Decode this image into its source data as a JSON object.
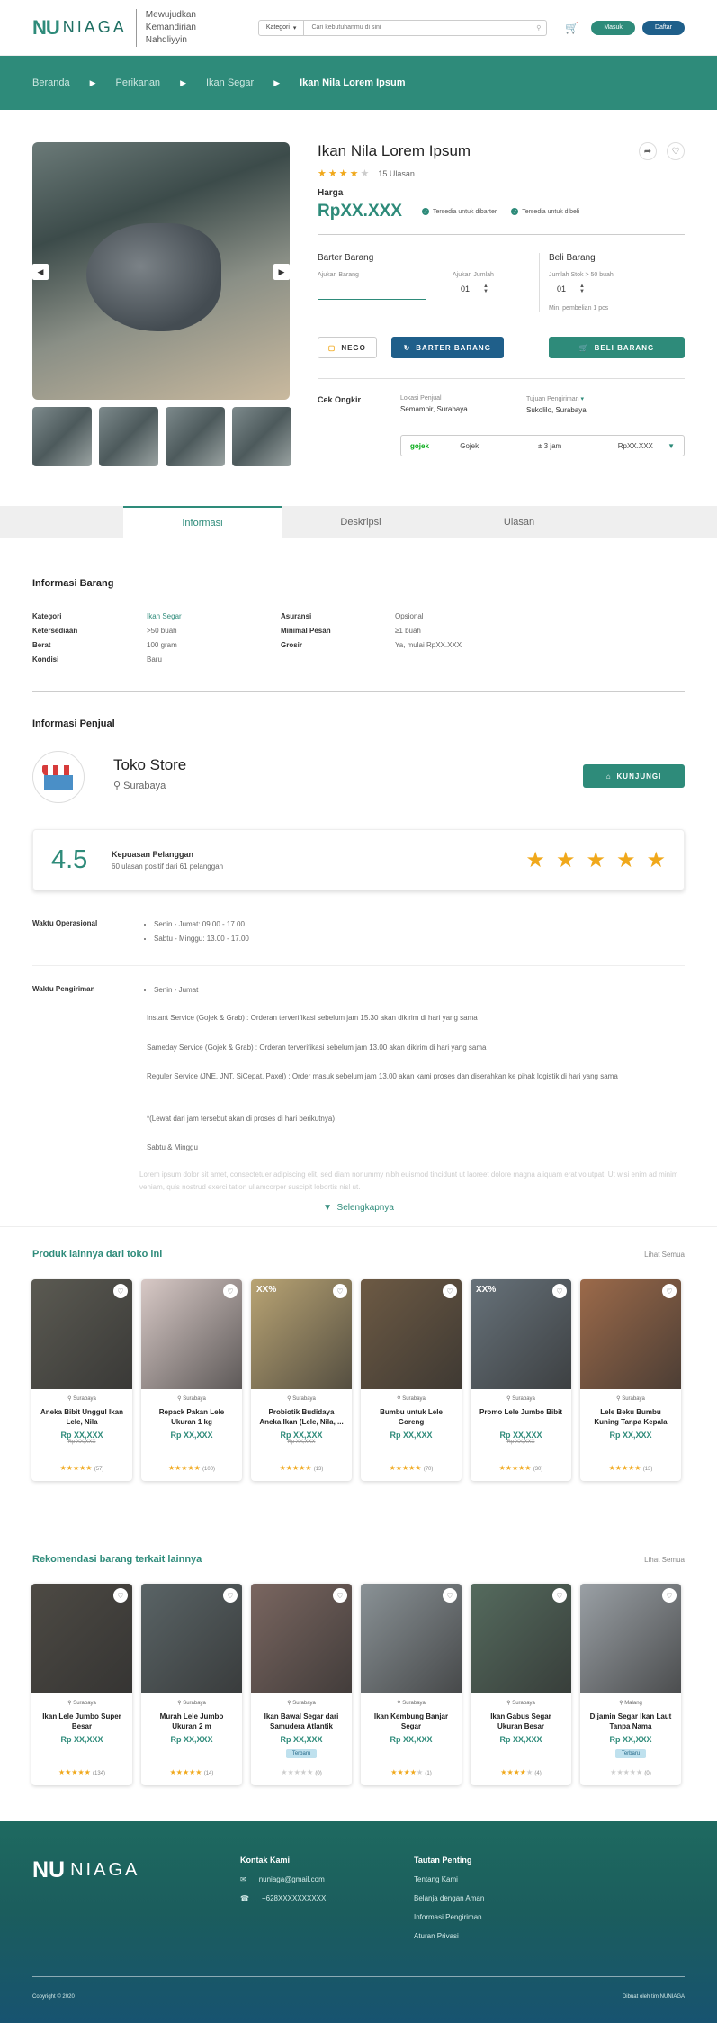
{
  "header": {
    "logo_nu": "NU",
    "logo_niaga": "NIAGA",
    "tagline": "Mewujudkan Kemandirian Nahdliyyin",
    "category_label": "Kategori",
    "search_placeholder": "Cari kebutuhanmu di sini",
    "login_label": "Masuk",
    "register_label": "Daftar"
  },
  "breadcrumb": [
    "Beranda",
    "Perikanan",
    "Ikan Segar",
    "Ikan Nila Lorem Ipsum"
  ],
  "product": {
    "title": "Ikan Nila Lorem Ipsum",
    "rating": 4,
    "reviews": "15 Ulasan",
    "price_label": "Harga",
    "price": "RpXX.XXX",
    "badge_barter": "Tersedia untuk dibarter",
    "badge_beli": "Tersedia untuk dibeli",
    "barter_heading": "Barter Barang",
    "barter_ajukan": "Ajukan Barang",
    "barter_qty_label": "Ajukan Jumlah",
    "barter_qty": "01",
    "beli_heading": "Beli Barang",
    "beli_stock": "Jumlah Stok > 50 buah",
    "beli_qty": "01",
    "beli_min": "Min. pembelian 1 pcs",
    "btn_nego": "NEGO",
    "btn_barter": "BARTER BARANG",
    "btn_beli": "BELI BARANG",
    "ongkir_label": "Cek Ongkir",
    "lokasi_label": "Lokasi Penjual",
    "lokasi_value": "Semampir, Surabaya",
    "tujuan_label": "Tujuan Pengiriman",
    "tujuan_value": "Sukolilo, Surabaya",
    "courier_brand": "gojek",
    "courier_service": "Gojek",
    "courier_eta": "± 3 jam",
    "courier_cost": "RpXX.XXX"
  },
  "tabs": [
    "Informasi",
    "Deskripsi",
    "Ulasan"
  ],
  "info": {
    "title": "Informasi Barang",
    "rows": [
      [
        "Kategori",
        "Ikan Segar",
        "Asuransi",
        "Opsional"
      ],
      [
        "Ketersediaan",
        ">50 buah",
        "Minimal Pesan",
        "≥1 buah"
      ],
      [
        "Berat",
        "100 gram",
        "Grosir",
        "Ya, mulai RpXX.XXX"
      ],
      [
        "Kondisi",
        "Baru",
        "",
        ""
      ]
    ]
  },
  "seller": {
    "title": "Informasi Penjual",
    "name": "Toko Store",
    "city": "Surabaya",
    "visit_label": "KUNJUNGI",
    "score": "4.5",
    "score_title": "Kepuasan Pelanggan",
    "score_sub": "60 ulasan positif dari 61 pelanggan",
    "ops_label": "Waktu Operasional",
    "ops": [
      "Senin - Jumat: 09.00 - 17.00",
      "Sabtu - Minggu: 13.00 - 17.00"
    ],
    "ship_label": "Waktu Pengiriman",
    "ship_heading": "Senin - Jumat",
    "ship_lines": [
      "Instant Service (Gojek & Grab) : Orderan terverifikasi sebelum jam 15.30 akan dikirim di hari yang sama",
      "Sameday Service (Gojek & Grab) : Orderan terverifikasi sebelum jam 13.00 akan dikirim di hari yang sama",
      "Reguler Service (JNE, JNT, SiCepat, Paxel) : Order masuk sebelum jam 13.00 akan kami proses dan diserahkan ke pihak logistik di hari yang sama",
      "*(Lewat dari jam tersebut akan di proses di hari berikutnya)",
      "Sabtu & Minggu"
    ],
    "ship_fade": "Lorem ipsum dolor sit amet, consectetuer adipiscing elit, sed diam nonummy nibh euismod tincidunt ut laoreet dolore magna aliquam erat volutpat. Ut wisi enim ad minim veniam, quis nostrud exerci tation ullamcorper suscipit lobortis nisl ut.",
    "more_label": "Selengkapnya"
  },
  "store_products": {
    "title": "Produk lainnya dari toko ini",
    "see_all": "Lihat Semua",
    "items": [
      {
        "city": "Surabaya",
        "name": "Aneka Bibit Unggul Ikan Lele, Nila",
        "price": "Rp XX,XXX",
        "old": "Rp XX,XXX",
        "disc": "",
        "rating": 5,
        "count": "(57)",
        "tag": "",
        "color": "#5b5a52"
      },
      {
        "city": "Surabaya",
        "name": "Repack Pakan Lele Ukuran 1 kg",
        "price": "Rp XX,XXX",
        "old": "",
        "disc": "",
        "rating": 5,
        "count": "(100)",
        "tag": "",
        "color": "#d8c9c6"
      },
      {
        "city": "Surabaya",
        "name": "Probiotik Budidaya Aneka Ikan (Lele, Nila, ...",
        "price": "Rp XX,XXX",
        "old": "Rp XX,XXX",
        "disc": "XX%",
        "rating": 5,
        "count": "(13)",
        "tag": "",
        "color": "#b9a474"
      },
      {
        "city": "Surabaya",
        "name": "Bumbu untuk Lele Goreng",
        "price": "Rp XX,XXX",
        "old": "",
        "disc": "",
        "rating": 5,
        "count": "(70)",
        "tag": "",
        "color": "#6d5a44"
      },
      {
        "city": "Surabaya",
        "name": "Promo Lele Jumbo Bibit",
        "price": "Rp XX,XXX",
        "old": "Rp XX,XXX",
        "disc": "XX%",
        "rating": 5,
        "count": "(30)",
        "tag": "",
        "color": "#67727a"
      },
      {
        "city": "Surabaya",
        "name": "Lele Beku Bumbu Kuning Tanpa Kepala",
        "price": "Rp XX,XXX",
        "old": "",
        "disc": "",
        "rating": 5,
        "count": "(13)",
        "tag": "",
        "color": "#9c6a4a"
      }
    ]
  },
  "recommend": {
    "title": "Rekomendasi barang terkait lainnya",
    "see_all": "Lihat Semua",
    "items": [
      {
        "city": "Surabaya",
        "name": "Ikan Lele Jumbo Super Besar",
        "price": "Rp XX,XXX",
        "old": "",
        "disc": "",
        "rating": 5,
        "count": "(134)",
        "tag": "",
        "color": "#4d4a44"
      },
      {
        "city": "Surabaya",
        "name": "Murah Lele Jumbo Ukuran 2 m",
        "price": "Rp XX,XXX",
        "old": "",
        "disc": "",
        "rating": 5,
        "count": "(14)",
        "tag": "",
        "color": "#5a6466"
      },
      {
        "city": "Surabaya",
        "name": "Ikan Bawal Segar dari Samudera Atlantik",
        "price": "Rp XX,XXX",
        "old": "",
        "disc": "",
        "rating": 0,
        "count": "(0)",
        "tag": "Terbaru",
        "color": "#7a6660"
      },
      {
        "city": "Surabaya",
        "name": "Ikan Kembung Banjar Segar",
        "price": "Rp XX,XXX",
        "old": "",
        "disc": "",
        "rating": 4,
        "count": "(1)",
        "tag": "",
        "color": "#8a9296"
      },
      {
        "city": "Surabaya",
        "name": "Ikan Gabus Segar Ukuran Besar",
        "price": "Rp XX,XXX",
        "old": "",
        "disc": "",
        "rating": 4,
        "count": "(4)",
        "tag": "",
        "color": "#556b5e"
      },
      {
        "city": "Malang",
        "name": "Dijamin Segar Ikan Laut Tanpa Nama",
        "price": "Rp XX,XXX",
        "old": "",
        "disc": "",
        "rating": 0,
        "count": "(0)",
        "tag": "Terbaru",
        "color": "#9aa0a5"
      }
    ]
  },
  "footer": {
    "contact_title": "Kontak Kami",
    "email": "nuniaga@gmail.com",
    "phone": "+628XXXXXXXXXX",
    "links_title": "Tautan Penting",
    "links": [
      "Tentang Kami",
      "Belanja dengan Aman",
      "Informasi Pengiriman",
      "Aturan Privasi"
    ],
    "copyright": "Copyright © 2020",
    "credit": "Dibuat oleh tim NUNIAGA"
  }
}
